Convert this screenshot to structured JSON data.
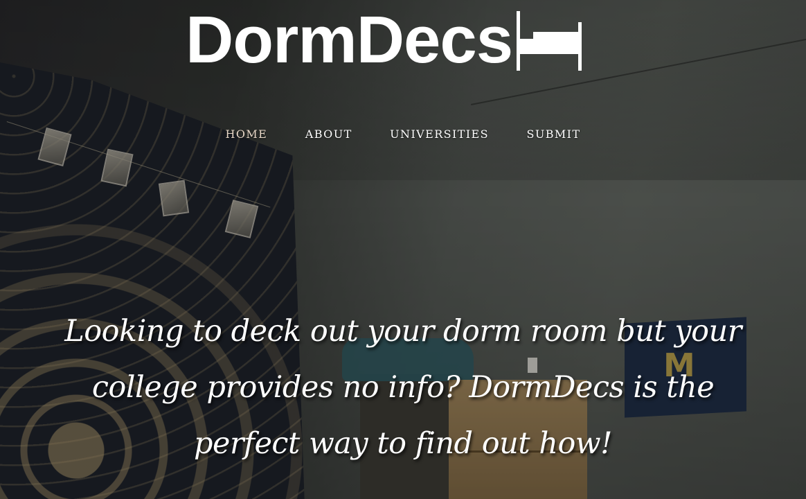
{
  "logo": {
    "text": "DormDecs",
    "icon": "bed-icon"
  },
  "nav": {
    "items": [
      {
        "label": "HOME",
        "active": true
      },
      {
        "label": "ABOUT",
        "active": false
      },
      {
        "label": "UNIVERSITIES",
        "active": false
      },
      {
        "label": "SUBMIT",
        "active": false
      }
    ]
  },
  "hero": {
    "tagline": "Looking to deck out your dorm room but your college provides no info? DormDecs is the perfect way to find out how!",
    "background": "dorm-room-photo",
    "pennant_letter": "M"
  },
  "colors": {
    "text": "#ffffff",
    "nav_active": "#e8d8c8"
  }
}
